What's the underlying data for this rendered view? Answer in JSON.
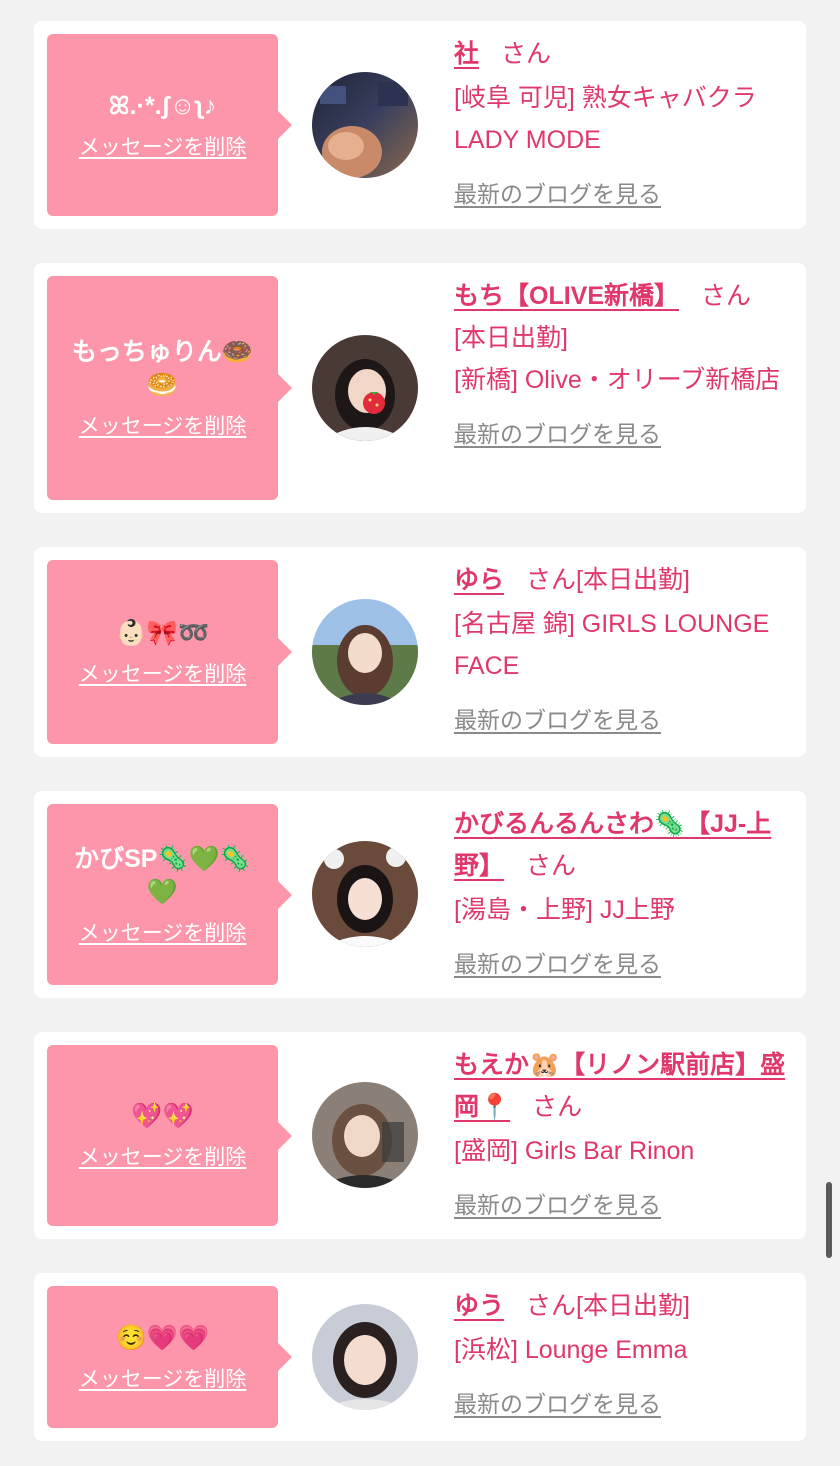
{
  "cards": [
    {
      "message": "ꕤ.·*.ʃ☺ʅ♪",
      "delete_label": "メッセージを削除",
      "name": "社",
      "san": "さん",
      "status": "",
      "shop": "[岐阜 可児] 熟女キャバクラLADY MODE",
      "blog_label": "最新のブログを見る"
    },
    {
      "message": "もっちゅりん🍩🥯",
      "delete_label": "メッセージを削除",
      "name": "もち【OLIVE新橋】",
      "san": "さん",
      "status": "[本日出勤]",
      "shop": "[新橋] Olive・オリーブ新橋店",
      "blog_label": "最新のブログを見る"
    },
    {
      "message": "👶🏻🎀➿",
      "delete_label": "メッセージを削除",
      "name": "ゆら",
      "san": "さん",
      "status": "[本日出勤]",
      "shop": "[名古屋 錦] GIRLS LOUNGE FACE",
      "blog_label": "最新のブログを見る"
    },
    {
      "message": "かびSP🦠💚🦠💚",
      "delete_label": "メッセージを削除",
      "name": "かびるんるんさわ🦠【JJ-上野】",
      "san": "さん",
      "status": "",
      "shop": "[湯島・上野] JJ上野",
      "blog_label": "最新のブログを見る"
    },
    {
      "message": "💖💖",
      "delete_label": "メッセージを削除",
      "name": "もえか🐹【リノン駅前店】盛岡📍",
      "san": "さん",
      "status": "",
      "shop": "[盛岡] Girls Bar Rinon",
      "blog_label": "最新のブログを見る"
    },
    {
      "message": "☺️💗💗",
      "delete_label": "メッセージを削除",
      "name": "ゆう",
      "san": "さん",
      "status": "[本日出勤]",
      "shop": "[浜松] Lounge Emma",
      "blog_label": "最新のブログを見る"
    }
  ],
  "colors": {
    "page_background": "#f2f2f2",
    "card_background": "#ffffff",
    "bubble_pink": "#fd96aa",
    "name_pink": "#e0386a",
    "blog_gray": "#8a8a8a"
  }
}
